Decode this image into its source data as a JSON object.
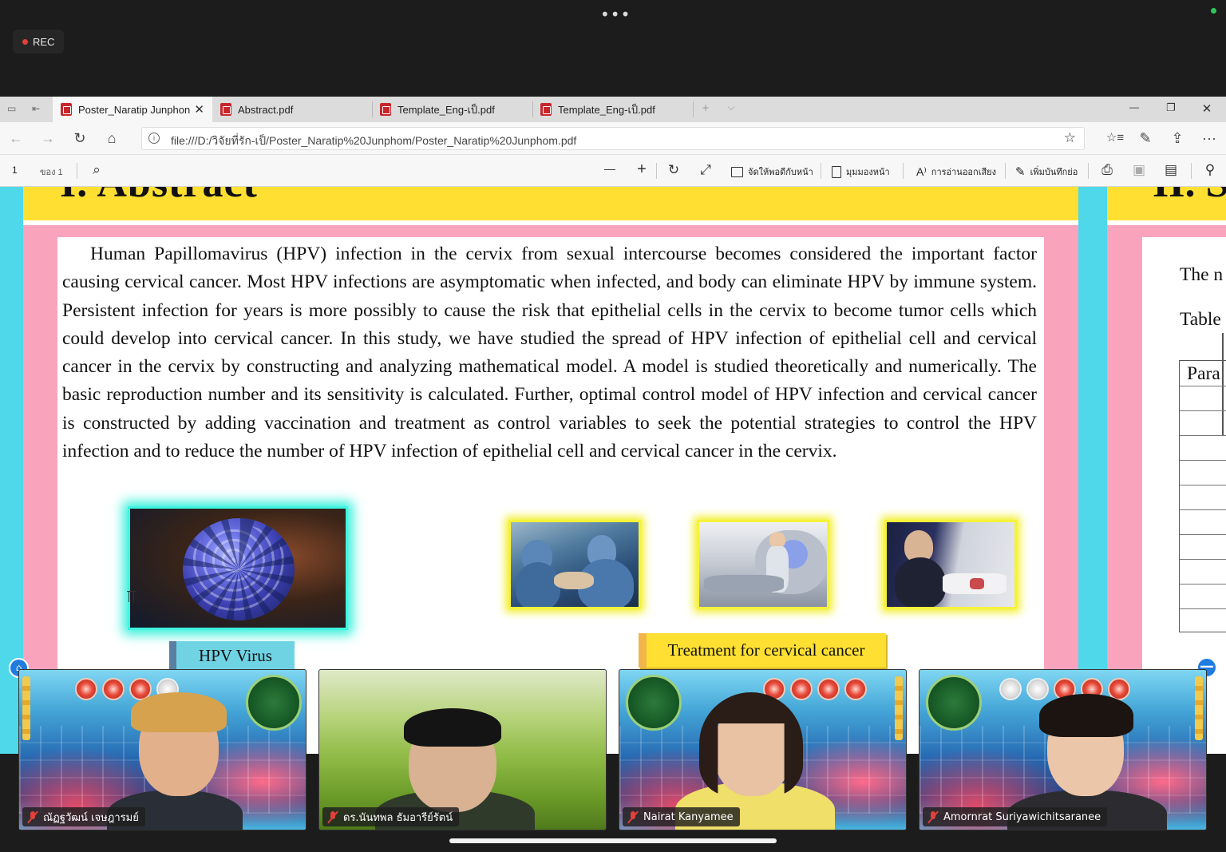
{
  "zoom": {
    "more_dots": "•••",
    "rec_label": "REC"
  },
  "browser": {
    "tabs": [
      {
        "title": "Poster_Naratip Junphon",
        "active": true
      },
      {
        "title": "Abstract.pdf",
        "active": false
      },
      {
        "title": "Template_Eng-เป็.pdf",
        "active": false
      },
      {
        "title": "Template_Eng-เป็.pdf",
        "active": false
      }
    ],
    "new_tab": "+",
    "tab_list": "⌵",
    "tab_close": "✕",
    "window_controls": {
      "minimize": "—",
      "maximize": "❐",
      "close": "✕"
    },
    "url": "file:///D:/วิจัยที่รัก-เป็/Poster_Naratip%20Junphom/Poster_Naratip%20Junphom.pdf",
    "nav": {
      "back": "←",
      "forward": "→",
      "refresh": "↻",
      "home": "⌂",
      "favorite": "☆",
      "collections": "☆≡",
      "pen": "✎",
      "share": "⇪",
      "more": "···"
    }
  },
  "pdf_toolbar": {
    "page_number": "1",
    "page_of": "ของ 1",
    "search_icon": "⌕",
    "zoom_out": "—",
    "zoom_in": "+",
    "rotate": "↻",
    "fit": "⤢",
    "fit_page_label": "จัดให้พอดีกับหน้า",
    "page_view_label": "มุมมองหน้า",
    "read_aloud_label": "การอ่านออกเสียง",
    "add_text_label": "เพิ่มบันทึกย่อ",
    "read_aloud_icon": "A⁾",
    "print_icon": "⎙",
    "save_icon": "▣",
    "save_as_icon": "▤",
    "pin_icon": "⚲"
  },
  "poster": {
    "section_title": "I. Abstract",
    "right_section_title": "II. S",
    "abstract_text": "Human Papillomavirus (HPV) infection in the cervix from sexual intercourse becomes considered the important factor causing cervical cancer. Most HPV infections are asymptomatic when infected, and body can eliminate HPV by immune system. Persistent infection for years is more possibly to cause the risk that epithelial cells in the cervix to become tumor cells which could develop into cervical cancer. In this study, we have studied the spread of HPV infection of epithelial cell and cervical cancer in the cervix by constructing and analyzing mathematical model. A model is studied theoretically and numerically. The basic reproduction number and its sensitivity is calculated. Further, optimal control model of HPV infection and cervical cancer is constructed by adding vaccination and treatment as control variables to seek the potential strategies to control the HPV infection and to reduce the number of HPV infection of epithelial cell and cervical cancer in the cervix.",
    "hpv_label": "HPV Virus",
    "treatment_label": "Treatment for cervical cancer",
    "right_line1": "The n",
    "right_line2": "Table",
    "right_table_head": "Para"
  },
  "participants": [
    {
      "name": "ณัฏฐวัฒน์ เจษฎารมย์",
      "muted": true
    },
    {
      "name": "ดร.นันทพล ธัมอารีย์รัตน์",
      "muted": true
    },
    {
      "name": "Nairat Kanyamee",
      "muted": true
    },
    {
      "name": "Amornrat Suriyawichitsaranee",
      "muted": true
    }
  ],
  "side_icons": {
    "left": "👤",
    "right": "—"
  },
  "colors": {
    "poster_cyan": "#4fd8ea",
    "poster_yellow": "#ffe032",
    "poster_pink": "#f9a3bd",
    "rec_red": "#e0413a"
  }
}
